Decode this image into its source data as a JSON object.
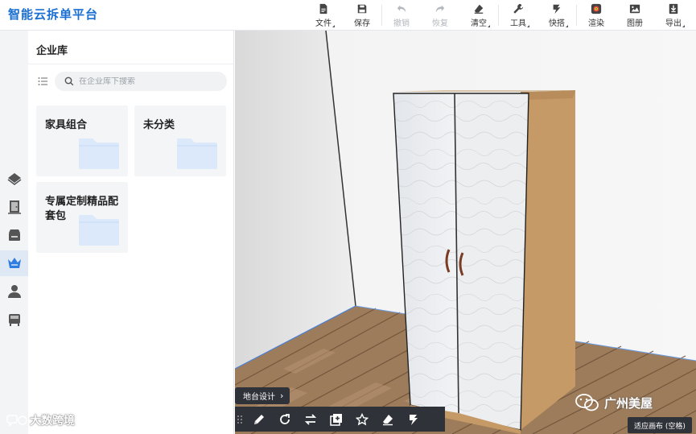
{
  "app": {
    "title": "智能云拆单平台"
  },
  "toolbar": {
    "items": [
      {
        "label": "文件",
        "icon": "file-icon",
        "disabled": false
      },
      {
        "label": "保存",
        "icon": "save-icon",
        "disabled": false
      },
      {
        "label": "撤销",
        "icon": "undo-icon",
        "disabled": true
      },
      {
        "label": "恢复",
        "icon": "redo-icon",
        "disabled": true
      },
      {
        "label": "清空",
        "icon": "eraser-icon",
        "disabled": false
      },
      {
        "label": "工具",
        "icon": "wrench-icon",
        "disabled": false
      },
      {
        "label": "快搭",
        "icon": "lightning-icon",
        "disabled": false
      },
      {
        "label": "渲染",
        "icon": "render-icon",
        "disabled": false
      },
      {
        "label": "图册",
        "icon": "album-icon",
        "disabled": false
      },
      {
        "label": "导出",
        "icon": "export-icon",
        "disabled": false
      }
    ]
  },
  "rail": {
    "items": [
      {
        "icon": "floor-plan-icon"
      },
      {
        "icon": "door-icon"
      },
      {
        "icon": "cabinet-icon"
      },
      {
        "icon": "crown-library-icon",
        "active": true
      },
      {
        "icon": "user-icon"
      },
      {
        "icon": "furniture-icon"
      }
    ]
  },
  "library": {
    "title": "企业库",
    "search_placeholder": "在企业库下搜索",
    "search_value": "",
    "folders": [
      {
        "name": "家具组合"
      },
      {
        "name": "未分类"
      },
      {
        "name": "专属定制精品配套包"
      }
    ]
  },
  "viewport": {
    "design_tag": "地台设计",
    "fit_button": "适应画布 (空格)",
    "tools": [
      {
        "icon": "pencil-icon"
      },
      {
        "icon": "rotate-icon"
      },
      {
        "icon": "mirror-icon"
      },
      {
        "icon": "add-copy-icon"
      },
      {
        "icon": "star-icon"
      },
      {
        "icon": "eraser-icon"
      },
      {
        "icon": "lightning-icon"
      }
    ]
  },
  "watermarks": {
    "left": "大数跨境",
    "right": "广州美屋"
  },
  "colors": {
    "brand": "#1a6fd1",
    "dark_bar": "#2f3238",
    "folder": "#dbe9fb"
  }
}
